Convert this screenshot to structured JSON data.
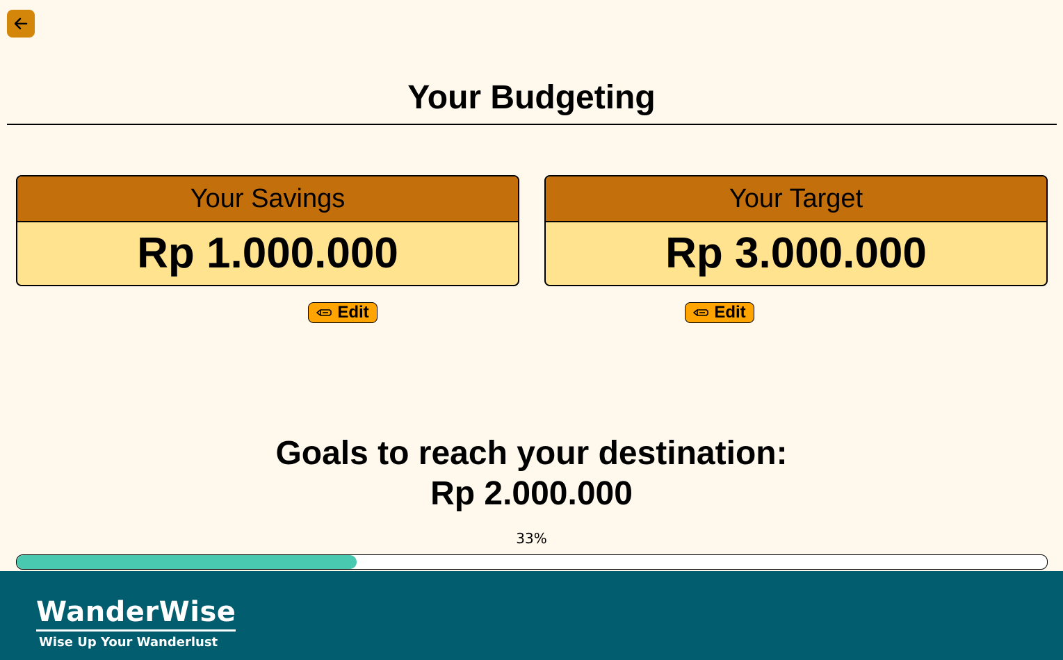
{
  "header": {
    "back_icon": "arrow-left-icon",
    "title": "Your Budgeting"
  },
  "savings": {
    "label": "Your Savings",
    "amount": "Rp 1.000.000",
    "edit_icon": "pencil-icon",
    "edit_label": "Edit"
  },
  "target": {
    "label": "Your Target",
    "amount": "Rp 3.000.000",
    "edit_icon": "pencil-icon",
    "edit_label": "Edit"
  },
  "goal": {
    "heading": "Goals to reach your destination:",
    "amount": "Rp 2.000.000"
  },
  "progress": {
    "label": "33%",
    "fraction": 0.33
  },
  "footer": {
    "brand": "WanderWise",
    "tagline": "Wise Up Your Wanderlust"
  },
  "colors": {
    "background": "#fff8ec",
    "accent": "#d4860b",
    "card_header": "#c36f0c",
    "card_body": "#ffe38e",
    "edit_button": "#ffa400",
    "progress_fill": "#48c9b0",
    "footer": "#025d6f"
  }
}
